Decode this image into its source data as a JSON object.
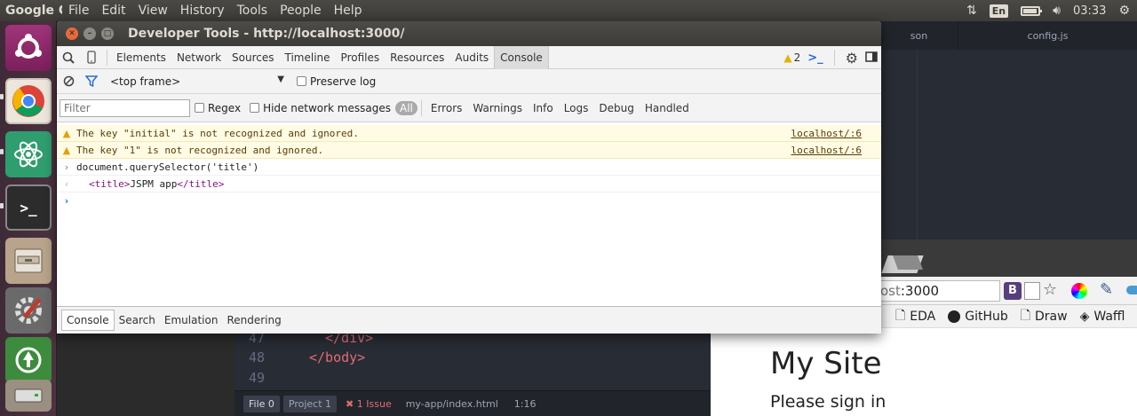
{
  "top_panel": {
    "app_name": "Google C",
    "menu": [
      "File",
      "Edit",
      "View",
      "History",
      "Tools",
      "People",
      "Help"
    ],
    "keyboard_layout": "En",
    "clock": "03:33"
  },
  "editor": {
    "tabs": [
      "son",
      "config.js"
    ],
    "lines": [
      {
        "num": "47",
        "indent": "      ",
        "tag": "</div>"
      },
      {
        "num": "48",
        "indent": "    ",
        "tag": "</body>"
      },
      {
        "num": "49",
        "indent": "",
        "tag": ""
      }
    ],
    "status": {
      "file_btn": "File 0",
      "project_btn": "Project 1",
      "issues": "1 Issue",
      "path": "my-app/index.html",
      "position": "1:16"
    }
  },
  "browser": {
    "url_prefix": "ost",
    "url_port": ":3000",
    "bookmarks": [
      "EDA",
      "GitHub",
      "Draw",
      "Waffl"
    ],
    "site_title": "My Site",
    "site_sub": "Please sign in"
  },
  "devtools": {
    "title": "Developer Tools - http://localhost:3000/",
    "tabs": [
      "Elements",
      "Network",
      "Sources",
      "Timeline",
      "Profiles",
      "Resources",
      "Audits",
      "Console"
    ],
    "active_tab": "Console",
    "warning_count": "2",
    "frame_select": "<top frame>",
    "preserve_log": "Preserve log",
    "filter_placeholder": "Filter",
    "regex_label": "Regex",
    "hide_network_label": "Hide network messages",
    "levels": [
      "All",
      "Errors",
      "Warnings",
      "Info",
      "Logs",
      "Debug",
      "Handled"
    ],
    "messages": [
      {
        "type": "warning",
        "text": "The key \"initial\" is not recognized and ignored.",
        "source": "localhost/:6"
      },
      {
        "type": "warning",
        "text": "The key \"1\" is not recognized and ignored.",
        "source": "localhost/:6"
      },
      {
        "type": "input",
        "text": "document.querySelector('title')"
      },
      {
        "type": "result",
        "open": "<title>",
        "inner": "JSPM app",
        "close": "</title>"
      }
    ],
    "drawer_tabs": [
      "Console",
      "Search",
      "Emulation",
      "Rendering"
    ]
  },
  "colors": {
    "launcher_bg": "#4d3341",
    "panel_bg": "#3c3b37",
    "warning_bg": "#fffbe5",
    "accent_blue": "#2a6bd4"
  }
}
